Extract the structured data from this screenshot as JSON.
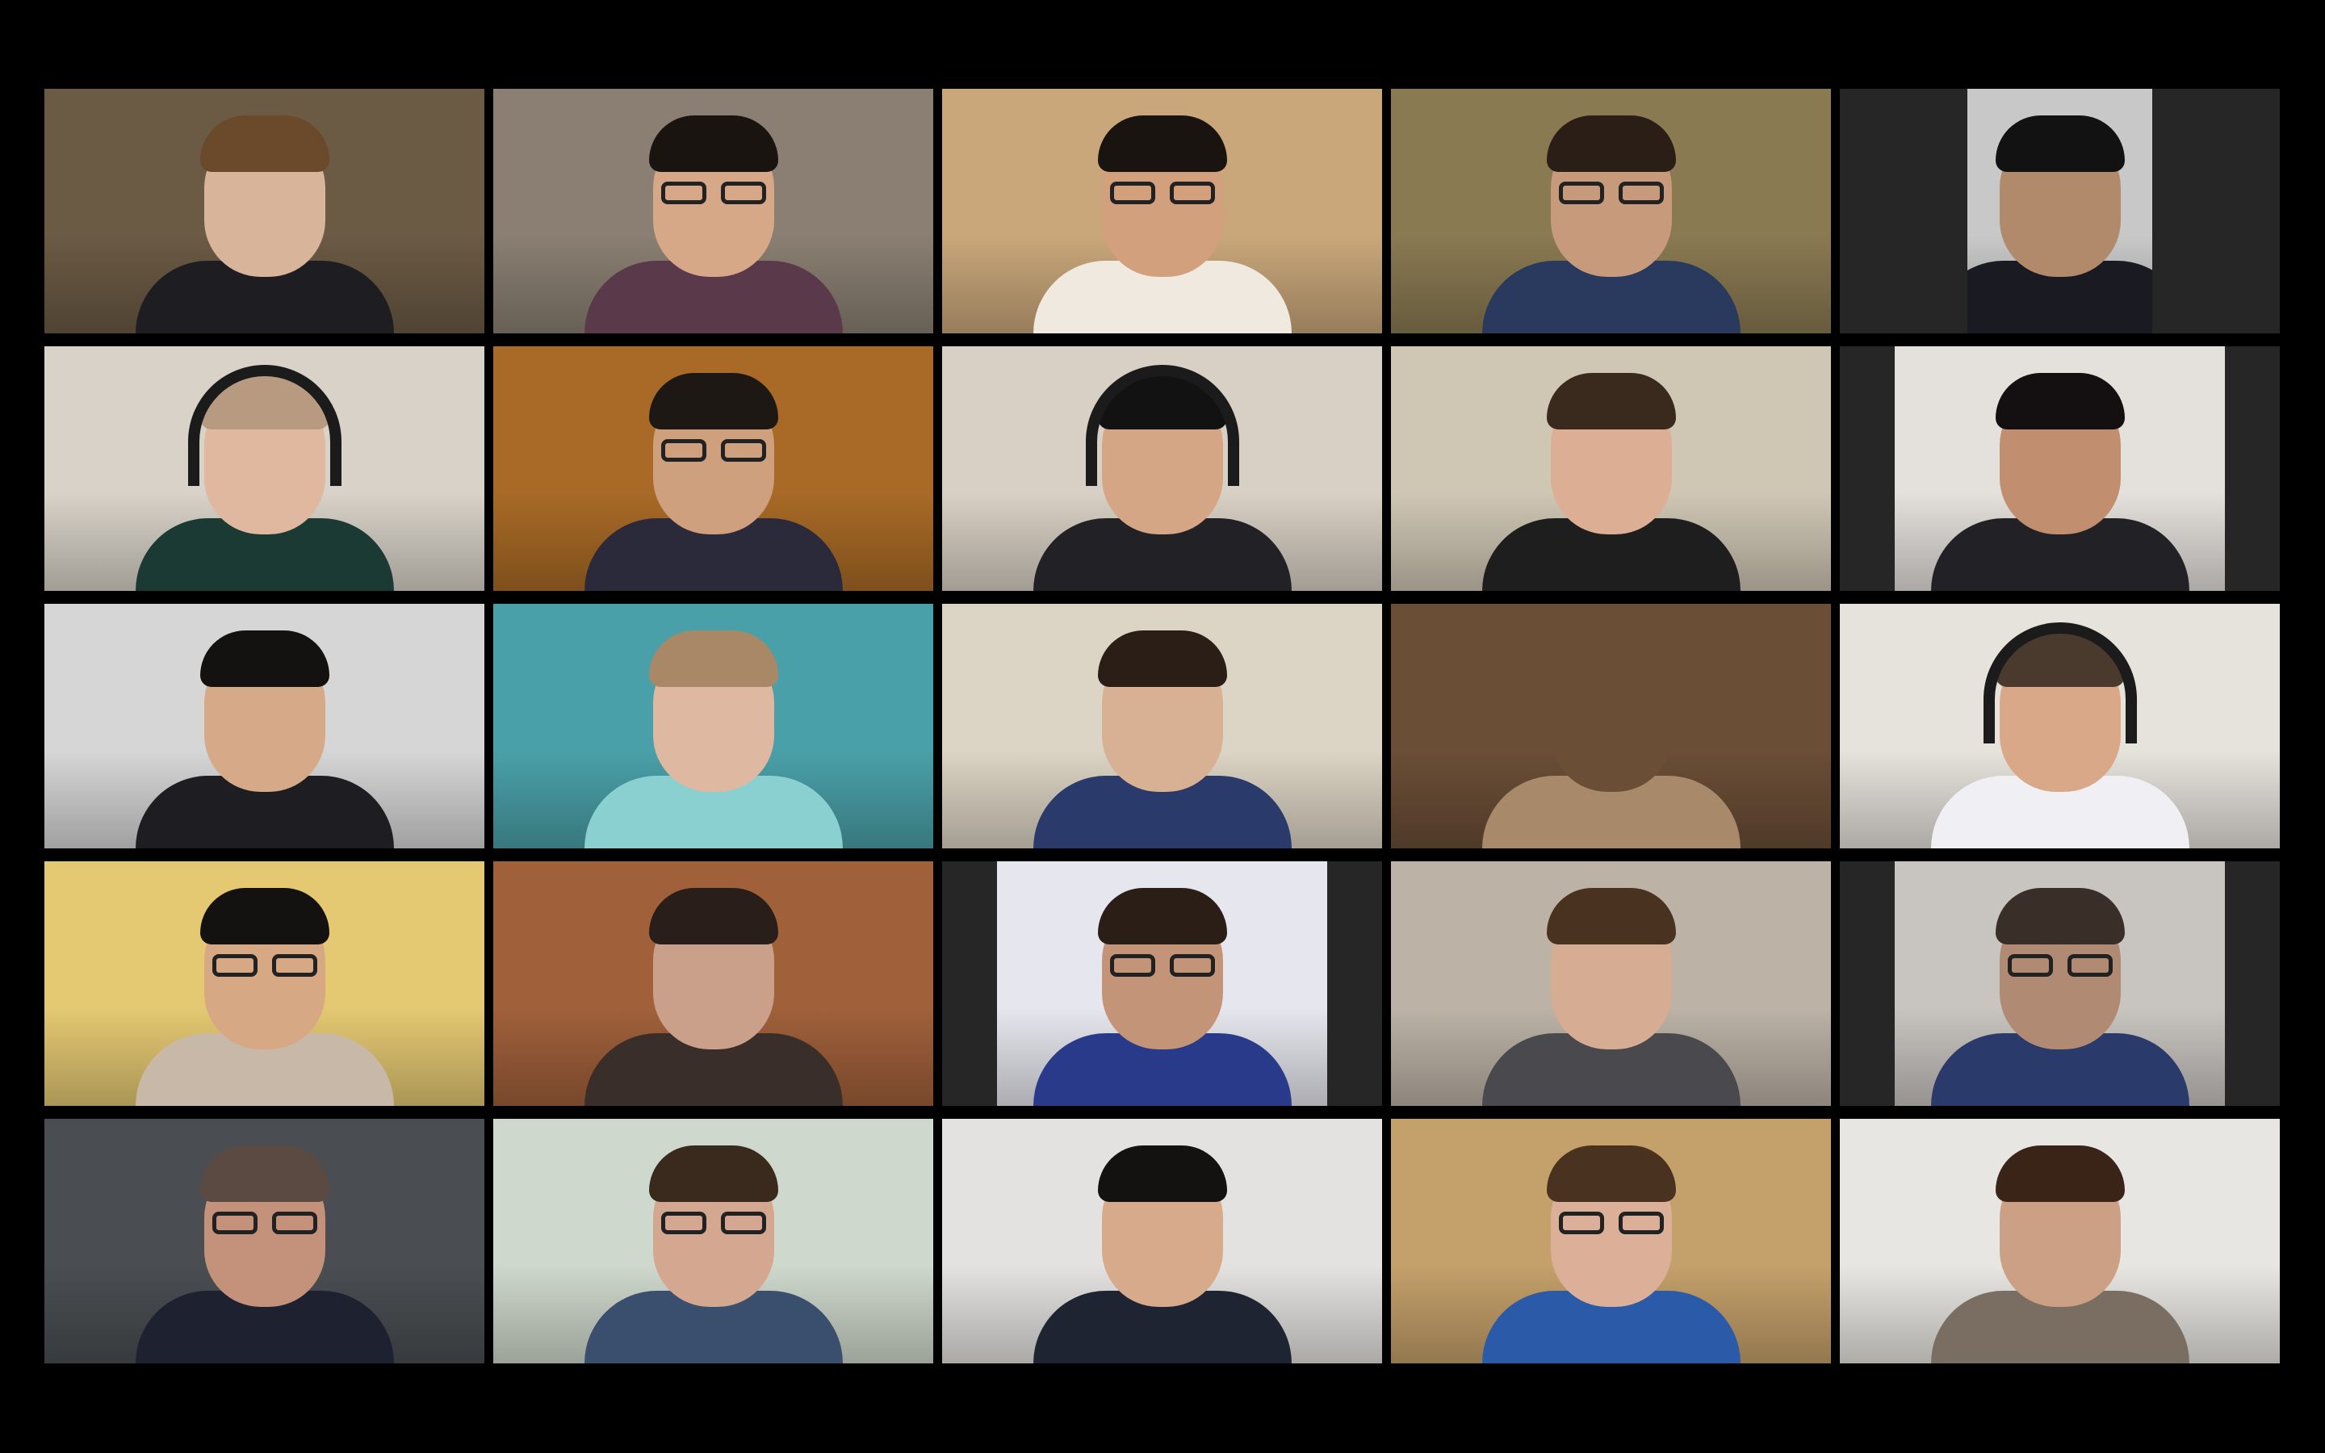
{
  "window": {
    "title": "",
    "background": "#000000"
  },
  "participants": [
    {
      "name": "",
      "wall": "#6b5a44",
      "skin": "#d8b49a",
      "hair": "#6a4a2a",
      "shirt": "#1e1e22",
      "glasses": false,
      "headset": false,
      "layout": "full"
    },
    {
      "name": "",
      "wall": "#8a7f72",
      "skin": "#d6a888",
      "hair": "#1a1410",
      "shirt": "#5a3a4a",
      "glasses": true,
      "headset": false,
      "layout": "full"
    },
    {
      "name": "",
      "wall": "#c9a77a",
      "skin": "#d2a07c",
      "hair": "#1a1410",
      "shirt": "#efe9df",
      "glasses": true,
      "headset": false,
      "layout": "full"
    },
    {
      "name": "",
      "wall": "#8a7a52",
      "skin": "#c89a7c",
      "hair": "#2a1e16",
      "shirt": "#2a3a5e",
      "glasses": true,
      "headset": false,
      "layout": "full"
    },
    {
      "name": "",
      "wall": "#c8c8c8",
      "skin": "#b08a6a",
      "hair": "#121212",
      "shirt": "#1a1a22",
      "glasses": false,
      "headset": false,
      "layout": "narrow-center"
    },
    {
      "name": "",
      "wall": "#d8d2c8",
      "skin": "#e0b8a0",
      "hair": "#b89a80",
      "shirt": "#1c3a34",
      "glasses": false,
      "headset": true,
      "layout": "full"
    },
    {
      "name": "",
      "wall": "#a86a26",
      "skin": "#cfa07e",
      "hair": "#1e1814",
      "shirt": "#2a2a3a",
      "glasses": true,
      "headset": false,
      "layout": "full"
    },
    {
      "name": "",
      "wall": "#d8d0c4",
      "skin": "#d4a686",
      "hair": "#121212",
      "shirt": "#222226",
      "glasses": false,
      "headset": true,
      "layout": "full"
    },
    {
      "name": "",
      "wall": "#cfc6b4",
      "skin": "#dcae94",
      "hair": "#3a2a1e",
      "shirt": "#1e1e1e",
      "glasses": false,
      "headset": false,
      "layout": "full"
    },
    {
      "name": "",
      "wall": "#e4e0dc",
      "skin": "#c28e70",
      "hair": "#141012",
      "shirt": "#222226",
      "glasses": false,
      "headset": false,
      "layout": "wide-center"
    },
    {
      "name": "",
      "wall": "#d6d6d6",
      "skin": "#d6aa88",
      "hair": "#141210",
      "shirt": "#1e1e22",
      "glasses": false,
      "headset": false,
      "layout": "full"
    },
    {
      "name": "",
      "wall": "#4aa0a8",
      "skin": "#deb8a0",
      "hair": "#a88866",
      "shirt": "#8ad0d0",
      "glasses": false,
      "headset": false,
      "layout": "full"
    },
    {
      "name": "",
      "wall": "#dcd4c4",
      "skin": "#d8b094",
      "hair": "#2a1e16",
      "shirt": "#2a3a6a",
      "glasses": false,
      "headset": false,
      "layout": "full"
    },
    {
      "name": "",
      "wall": "#6a4e36",
      "skin": "#6a4e36",
      "hair": "#6a4e36",
      "shirt": "#a88a6a",
      "glasses": false,
      "headset": false,
      "layout": "full"
    },
    {
      "name": "",
      "wall": "#e6e2dc",
      "skin": "#d8a888",
      "hair": "#4a3a2e",
      "shirt": "#f0f0f4",
      "glasses": false,
      "headset": true,
      "layout": "full"
    },
    {
      "name": "",
      "wall": "#e4c872",
      "skin": "#d6a884",
      "hair": "#141210",
      "shirt": "#c8b8a8",
      "glasses": true,
      "headset": false,
      "layout": "full"
    },
    {
      "name": "",
      "wall": "#a0603a",
      "skin": "#caa08a",
      "hair": "#2a1e1a",
      "shirt": "#3a2e2a",
      "glasses": false,
      "headset": false,
      "layout": "full"
    },
    {
      "name": "",
      "wall": "#e6e6ee",
      "skin": "#c49478",
      "hair": "#2a1e16",
      "shirt": "#2a3a8a",
      "glasses": true,
      "headset": false,
      "layout": "wide-center"
    },
    {
      "name": "",
      "wall": "#bcb2a6",
      "skin": "#d6ac92",
      "hair": "#4a3220",
      "shirt": "#4a4a4e",
      "glasses": false,
      "headset": false,
      "layout": "full"
    },
    {
      "name": "",
      "wall": "#c8c4c0",
      "skin": "#b08a72",
      "hair": "#3a2e28",
      "shirt": "#2a3a6a",
      "glasses": true,
      "headset": false,
      "layout": "wide-center"
    },
    {
      "name": "",
      "wall": "#4a4e52",
      "skin": "#c4927a",
      "hair": "#5a4a42",
      "shirt": "#1e2230",
      "glasses": true,
      "headset": false,
      "layout": "full"
    },
    {
      "name": "",
      "wall": "#cfd8cc",
      "skin": "#d4a890",
      "hair": "#3a2a1e",
      "shirt": "#3a4e6e",
      "glasses": true,
      "headset": false,
      "layout": "full"
    },
    {
      "name": "",
      "wall": "#e4e2e0",
      "skin": "#d6aa8a",
      "hair": "#141210",
      "shirt": "#1e2432",
      "glasses": false,
      "headset": false,
      "layout": "full"
    },
    {
      "name": "",
      "wall": "#c4a06a",
      "skin": "#dcb098",
      "hair": "#4a3220",
      "shirt": "#2a5aa8",
      "glasses": true,
      "headset": false,
      "layout": "full"
    },
    {
      "name": "",
      "wall": "#e8e6e2",
      "skin": "#cca084",
      "hair": "#3a2418",
      "shirt": "#7a6e62",
      "glasses": false,
      "headset": false,
      "layout": "full"
    }
  ]
}
